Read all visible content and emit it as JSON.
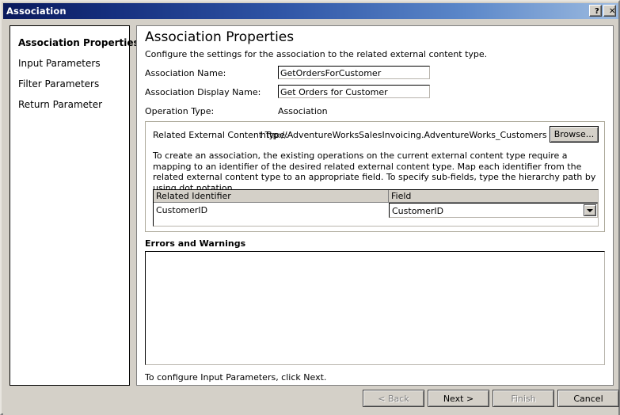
{
  "window": {
    "title": "Association",
    "help_button": "?",
    "close_button": "✕"
  },
  "sidebar": {
    "items": [
      {
        "label": "Association Properties",
        "selected": true
      },
      {
        "label": "Input Parameters",
        "selected": false
      },
      {
        "label": "Filter Parameters",
        "selected": false
      },
      {
        "label": "Return Parameter",
        "selected": false
      }
    ]
  },
  "main": {
    "title": "Association Properties",
    "description": "Configure the settings for the association to the related external content type.",
    "fields": [
      {
        "label": "Association Name:",
        "value": "GetOrdersForCustomer"
      },
      {
        "label": "Association Display Name:",
        "value": "Get Orders for Customer"
      },
      {
        "label": "Operation Type:",
        "value": "Association"
      }
    ],
    "group": {
      "related_label": "Related External Content Type:",
      "related_value": "http://AdventureWorksSalesInvoicing.AdventureWorks_Customers",
      "browse_label": "Browse...",
      "paragraph": "To create an association, the existing operations on the current external content type require a mapping to an identifier of the desired related external content type. Map each identifier from the related external content type to an appropriate field. To specify sub-fields, type the hierarchy path by using dot notation.",
      "grid": {
        "columns": [
          "Related Identifier",
          "Field"
        ],
        "rows": [
          {
            "identifier": "CustomerID",
            "field": "CustomerID"
          }
        ]
      }
    },
    "errors": {
      "label": "Errors and Warnings",
      "items": []
    },
    "hint": "To configure Input Parameters, click Next."
  },
  "footer": {
    "buttons": [
      {
        "label": "< Back",
        "enabled": false
      },
      {
        "label": "Next >",
        "enabled": true
      },
      {
        "label": "Finish",
        "enabled": false
      },
      {
        "label": "Cancel",
        "enabled": true
      }
    ]
  },
  "colors": {
    "window_bg": "#d4d0c8",
    "title_start": "#0a1a5c",
    "title_end": "#9dbbe0",
    "panel_bg": "#ffffff"
  }
}
